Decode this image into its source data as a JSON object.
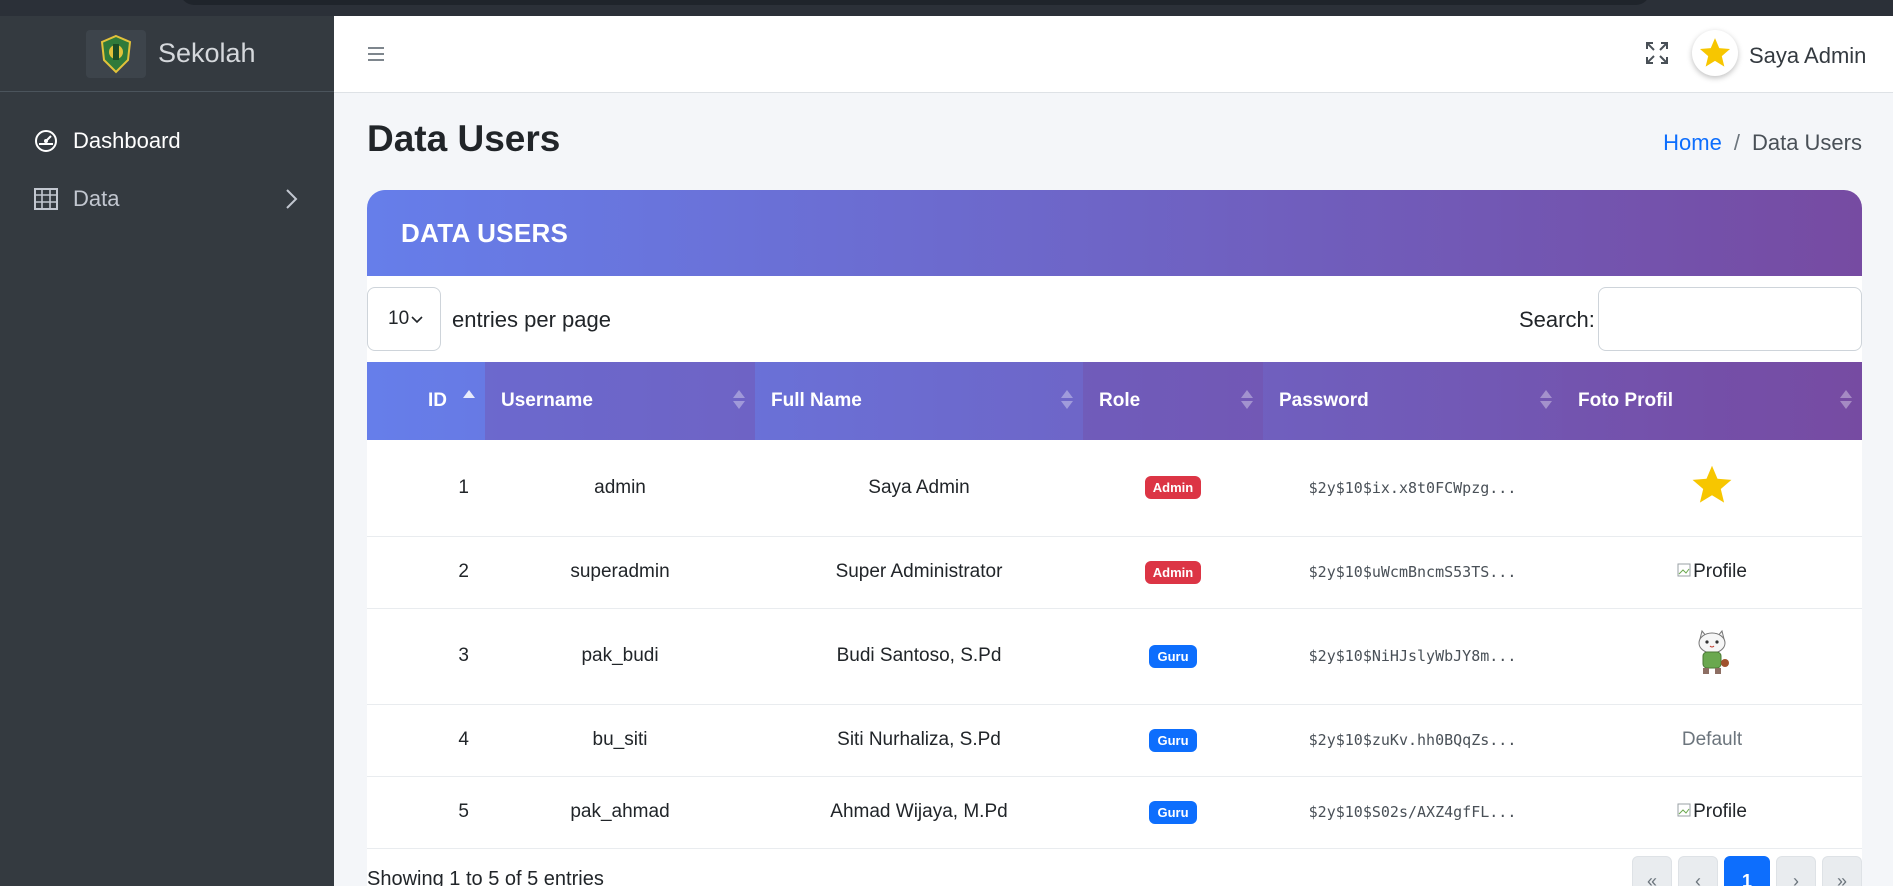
{
  "brand": {
    "name": "Sekolah"
  },
  "sidebar": {
    "items": [
      {
        "label": "Dashboard",
        "icon": "dashboard-icon"
      },
      {
        "label": "Data",
        "icon": "table-icon"
      }
    ]
  },
  "header": {
    "user_name": "Saya Admin"
  },
  "page": {
    "title": "Data Users"
  },
  "breadcrumb": {
    "home": "Home",
    "separator": "/",
    "current": "Data Users"
  },
  "card": {
    "title": "DATA USERS"
  },
  "controls": {
    "entries_value": "10",
    "entries_label": "entries per page",
    "search_label": "Search:",
    "search_value": ""
  },
  "table": {
    "columns": [
      "ID",
      "Username",
      "Full Name",
      "Role",
      "Password",
      "Foto Profil"
    ],
    "rows": [
      {
        "id": "1",
        "username": "admin",
        "full_name": "Saya Admin",
        "role": "Admin",
        "password": "$2y$10$ix.x8t0FCWpzg...",
        "foto": "star"
      },
      {
        "id": "2",
        "username": "superadmin",
        "full_name": "Super Administrator",
        "role": "Admin",
        "password": "$2y$10$uWcmBncmS53TS...",
        "foto": "Profile"
      },
      {
        "id": "3",
        "username": "pak_budi",
        "full_name": "Budi Santoso, S.Pd",
        "role": "Guru",
        "password": "$2y$10$NiHJslyWbJY8m...",
        "foto": "cat-character"
      },
      {
        "id": "4",
        "username": "bu_siti",
        "full_name": "Siti Nurhaliza, S.Pd",
        "role": "Guru",
        "password": "$2y$10$zuKv.hh0BQqZs...",
        "foto": "Default"
      },
      {
        "id": "5",
        "username": "pak_ahmad",
        "full_name": "Ahmad Wijaya, M.Pd",
        "role": "Guru",
        "password": "$2y$10$S02s/AXZ4gfFL...",
        "foto": "Profile"
      }
    ]
  },
  "footer": {
    "showing": "Showing 1 to 5 of 5 entries",
    "pagination": [
      "«",
      "‹",
      "1",
      "›",
      "»"
    ]
  },
  "colors": {
    "gradient_start": "#667eea",
    "gradient_end": "#764ba2",
    "admin_badge": "#dc3545",
    "guru_badge": "#0d6efd",
    "sidebar": "#343a40"
  }
}
